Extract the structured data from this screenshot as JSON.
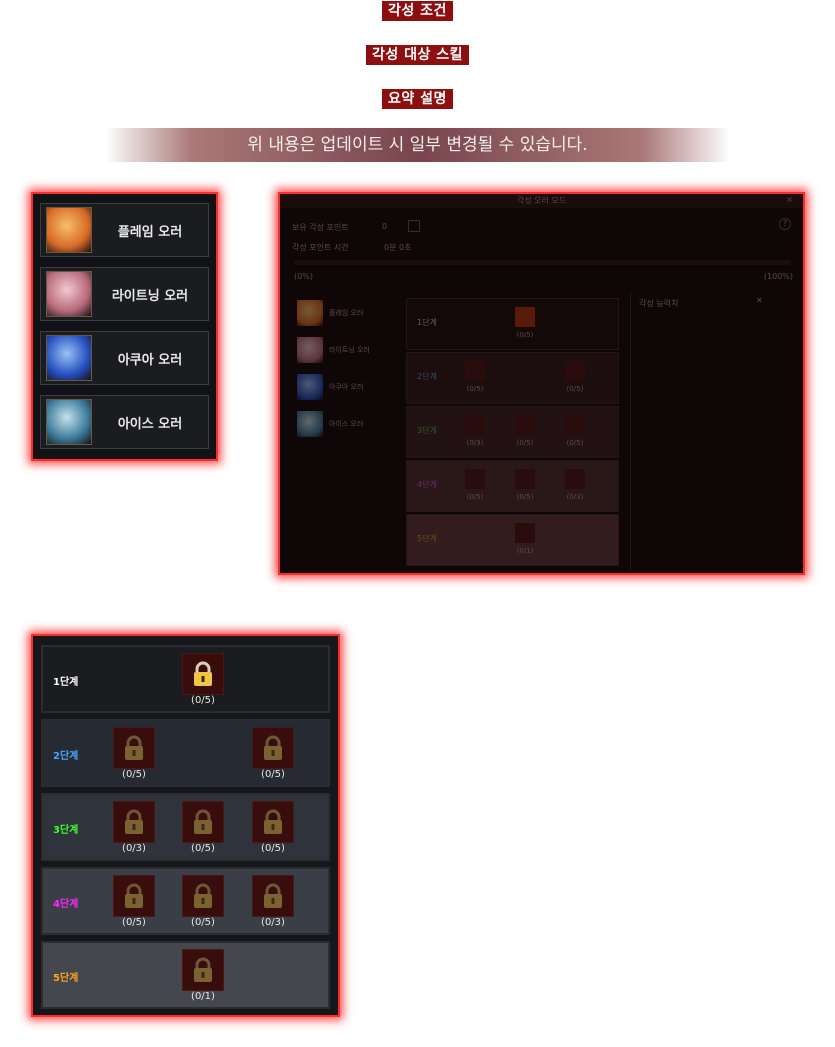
{
  "headers": [
    "각성 조건",
    "각성 대상 스킬",
    "요약 설명"
  ],
  "notice": "위 내용은 업데이트 시 일부 변경될 수 있습니다.",
  "aura_list": [
    {
      "label": "플레임 오러",
      "colors": [
        "#d96a28",
        "#f4c06a"
      ]
    },
    {
      "label": "라이트닝 오러",
      "colors": [
        "#b86a7a",
        "#f0c9d0"
      ]
    },
    {
      "label": "아쿠아 오러",
      "colors": [
        "#2450c0",
        "#9ac2f4"
      ]
    },
    {
      "label": "아이스 오러",
      "colors": [
        "#3a7a9a",
        "#c6e2ea"
      ]
    }
  ],
  "mini_window": {
    "title": "각성 오러 모드",
    "points_label": "보유 각성 포인트",
    "points_value": "0",
    "time_label": "각성 포인트 시간",
    "time_value": "0분 0초",
    "progress_min": "(0%)",
    "progress_max": "(100%)",
    "right_panel_label": "각성 능력치",
    "auras": [
      "플레임 오러",
      "라이트닝 오러",
      "아쿠아 오러",
      "아이스 오러"
    ]
  },
  "stages": [
    {
      "label": "1단계",
      "color": "#ffffff",
      "bg": "#1b1c20",
      "active": true,
      "counts": [
        "(0/5)"
      ]
    },
    {
      "label": "2단계",
      "color": "#4aa3ff",
      "bg": "#262a33",
      "active": false,
      "counts": [
        "(0/5)",
        "(0/5)"
      ]
    },
    {
      "label": "3단계",
      "color": "#3dff2e",
      "bg": "#2f333b",
      "active": false,
      "counts": [
        "(0/3)",
        "(0/5)",
        "(0/5)"
      ]
    },
    {
      "label": "4단계",
      "color": "#ff27ff",
      "bg": "#3a3e46",
      "active": false,
      "counts": [
        "(0/5)",
        "(0/5)",
        "(0/3)"
      ]
    },
    {
      "label": "5단계",
      "color": "#ffa21c",
      "bg": "#44474e",
      "active": false,
      "counts": [
        "(0/1)"
      ]
    }
  ]
}
